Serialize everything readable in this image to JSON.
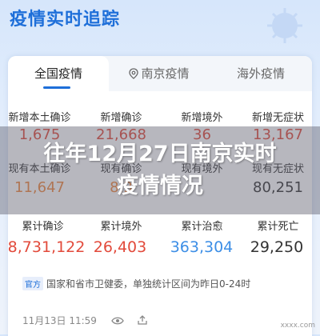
{
  "header": {
    "title": "疫情实时追踪"
  },
  "tabs": [
    {
      "label": "全国疫情",
      "active": true
    },
    {
      "label": "南京疫情",
      "active": false
    },
    {
      "label": "海外疫情",
      "active": false
    }
  ],
  "row1": [
    {
      "label": "新增本土确诊",
      "value": "1,675"
    },
    {
      "label": "新增确诊",
      "value": "21,668"
    },
    {
      "label": "新增境外",
      "value": "36"
    },
    {
      "label": "新增无症状",
      "value": "13,167"
    }
  ],
  "row2": [
    {
      "label": "现有本土确诊",
      "value": "11,647"
    },
    {
      "label": "现有确诊",
      "value": "8,3"
    },
    {
      "label": "现有境外",
      "value": ""
    },
    {
      "label": "现有无症状",
      "value": "80,251"
    }
  ],
  "overlay": {
    "line1": "往年12月27日南京实时",
    "line2": "疫情情况"
  },
  "totals": [
    {
      "label": "累计确诊",
      "value": "8,731,122"
    },
    {
      "label": "累计境外",
      "value": "26,403"
    },
    {
      "label": "累计治愈",
      "value": "363,304"
    },
    {
      "label": "累计死亡",
      "value": "29,250"
    }
  ],
  "source": {
    "badge": "官方",
    "text": "国家和省市卫健委，单独统计区间为昨日0-24时"
  },
  "footer": {
    "date": "11月13日 11:59"
  },
  "watermark": "xxxx.com",
  "colors": {
    "accent": "#1e6fd9",
    "red": "#e24a3b",
    "blue": "#3c8ee6",
    "green": "#21a689",
    "orange": "#f0883e"
  }
}
